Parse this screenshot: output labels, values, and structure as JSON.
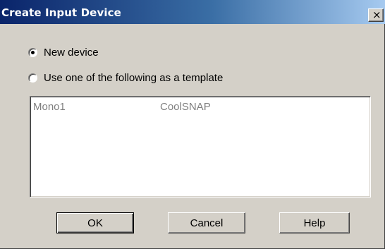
{
  "dialog": {
    "title": "Create Input Device",
    "close_glyph": "×"
  },
  "options": [
    {
      "label": "New device",
      "selected": true
    },
    {
      "label": "Use one of  the following as a template",
      "selected": false
    }
  ],
  "template_list": {
    "items": [
      "Mono1",
      "CoolSNAP"
    ],
    "enabled": false
  },
  "buttons": {
    "ok": "OK",
    "cancel": "Cancel",
    "help": "Help"
  },
  "colors": {
    "titlebar_start": "#0a246a",
    "titlebar_end": "#a6caf0",
    "face": "#d4d0c8",
    "disabled_text": "#808080"
  }
}
